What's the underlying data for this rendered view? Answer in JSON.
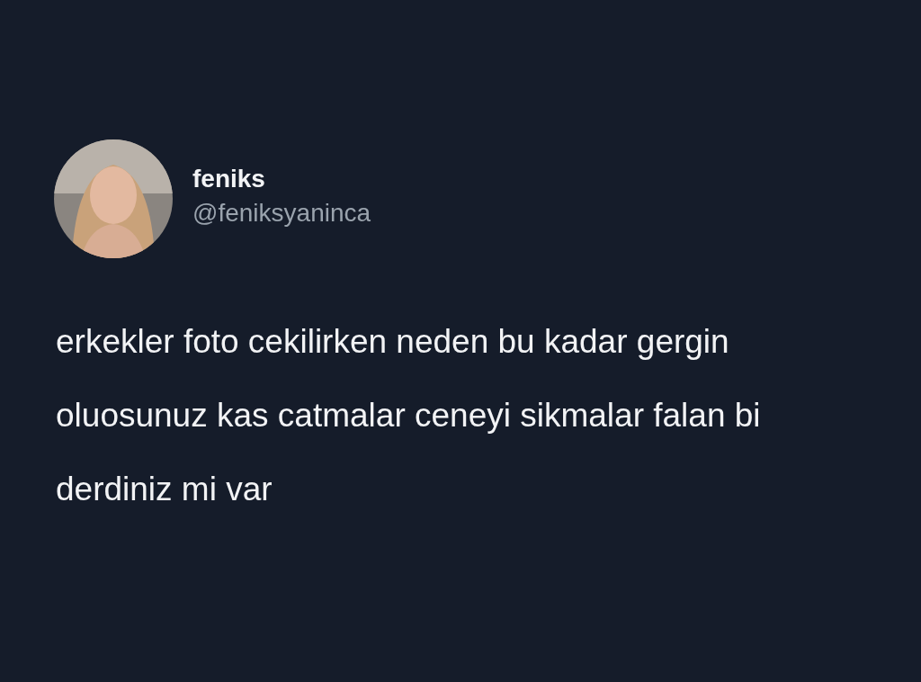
{
  "tweet": {
    "author": {
      "name": "feniks",
      "handle": "@feniksyaninca"
    },
    "text": "erkekler foto cekilirken neden bu kadar gergin oluosunuz kas catmalar ceneyi sikmalar falan bi derdiniz mi var"
  }
}
